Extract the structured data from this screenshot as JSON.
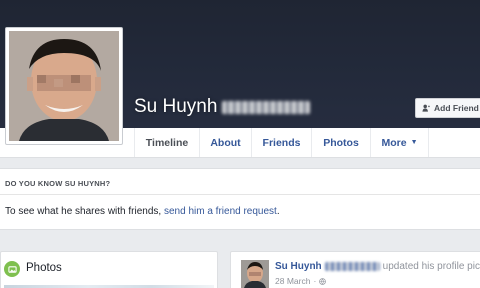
{
  "profile": {
    "name": "Su Huynh",
    "avatar_icon": "profile-photo"
  },
  "header": {
    "add_friend_label": "Add Friend",
    "add_friend_icon": "add-person-icon"
  },
  "nav": {
    "tabs": [
      {
        "label": "Timeline",
        "active": true
      },
      {
        "label": "About"
      },
      {
        "label": "Friends"
      },
      {
        "label": "Photos"
      },
      {
        "label": "More",
        "icon": "caret-down-icon"
      }
    ]
  },
  "know": {
    "heading": "DO YOU KNOW SU HUYNH?",
    "text_prefix": "To see what he shares with friends, ",
    "link": "send him a friend request",
    "text_suffix": "."
  },
  "photos_card": {
    "title": "Photos",
    "icon": "photos-icon"
  },
  "post": {
    "author": "Su Huynh",
    "action": "updated his profile pict",
    "date": "28 March",
    "privacy_icon": "globe-icon"
  },
  "colors": {
    "cover": "#232a3b",
    "link": "#365899",
    "page_bg": "#e9ebee"
  }
}
